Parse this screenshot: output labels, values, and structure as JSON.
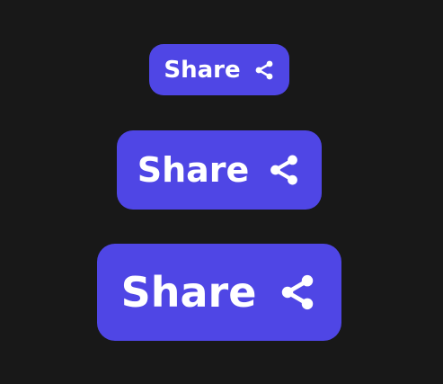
{
  "theme": {
    "background": "#181818",
    "accent": "#4f46e5",
    "text": "#ffffff"
  },
  "buttons": [
    {
      "size": "small",
      "label": "Share",
      "icon": "share-icon"
    },
    {
      "size": "medium",
      "label": "Share",
      "icon": "share-icon"
    },
    {
      "size": "large",
      "label": "Share",
      "icon": "share-icon"
    }
  ]
}
